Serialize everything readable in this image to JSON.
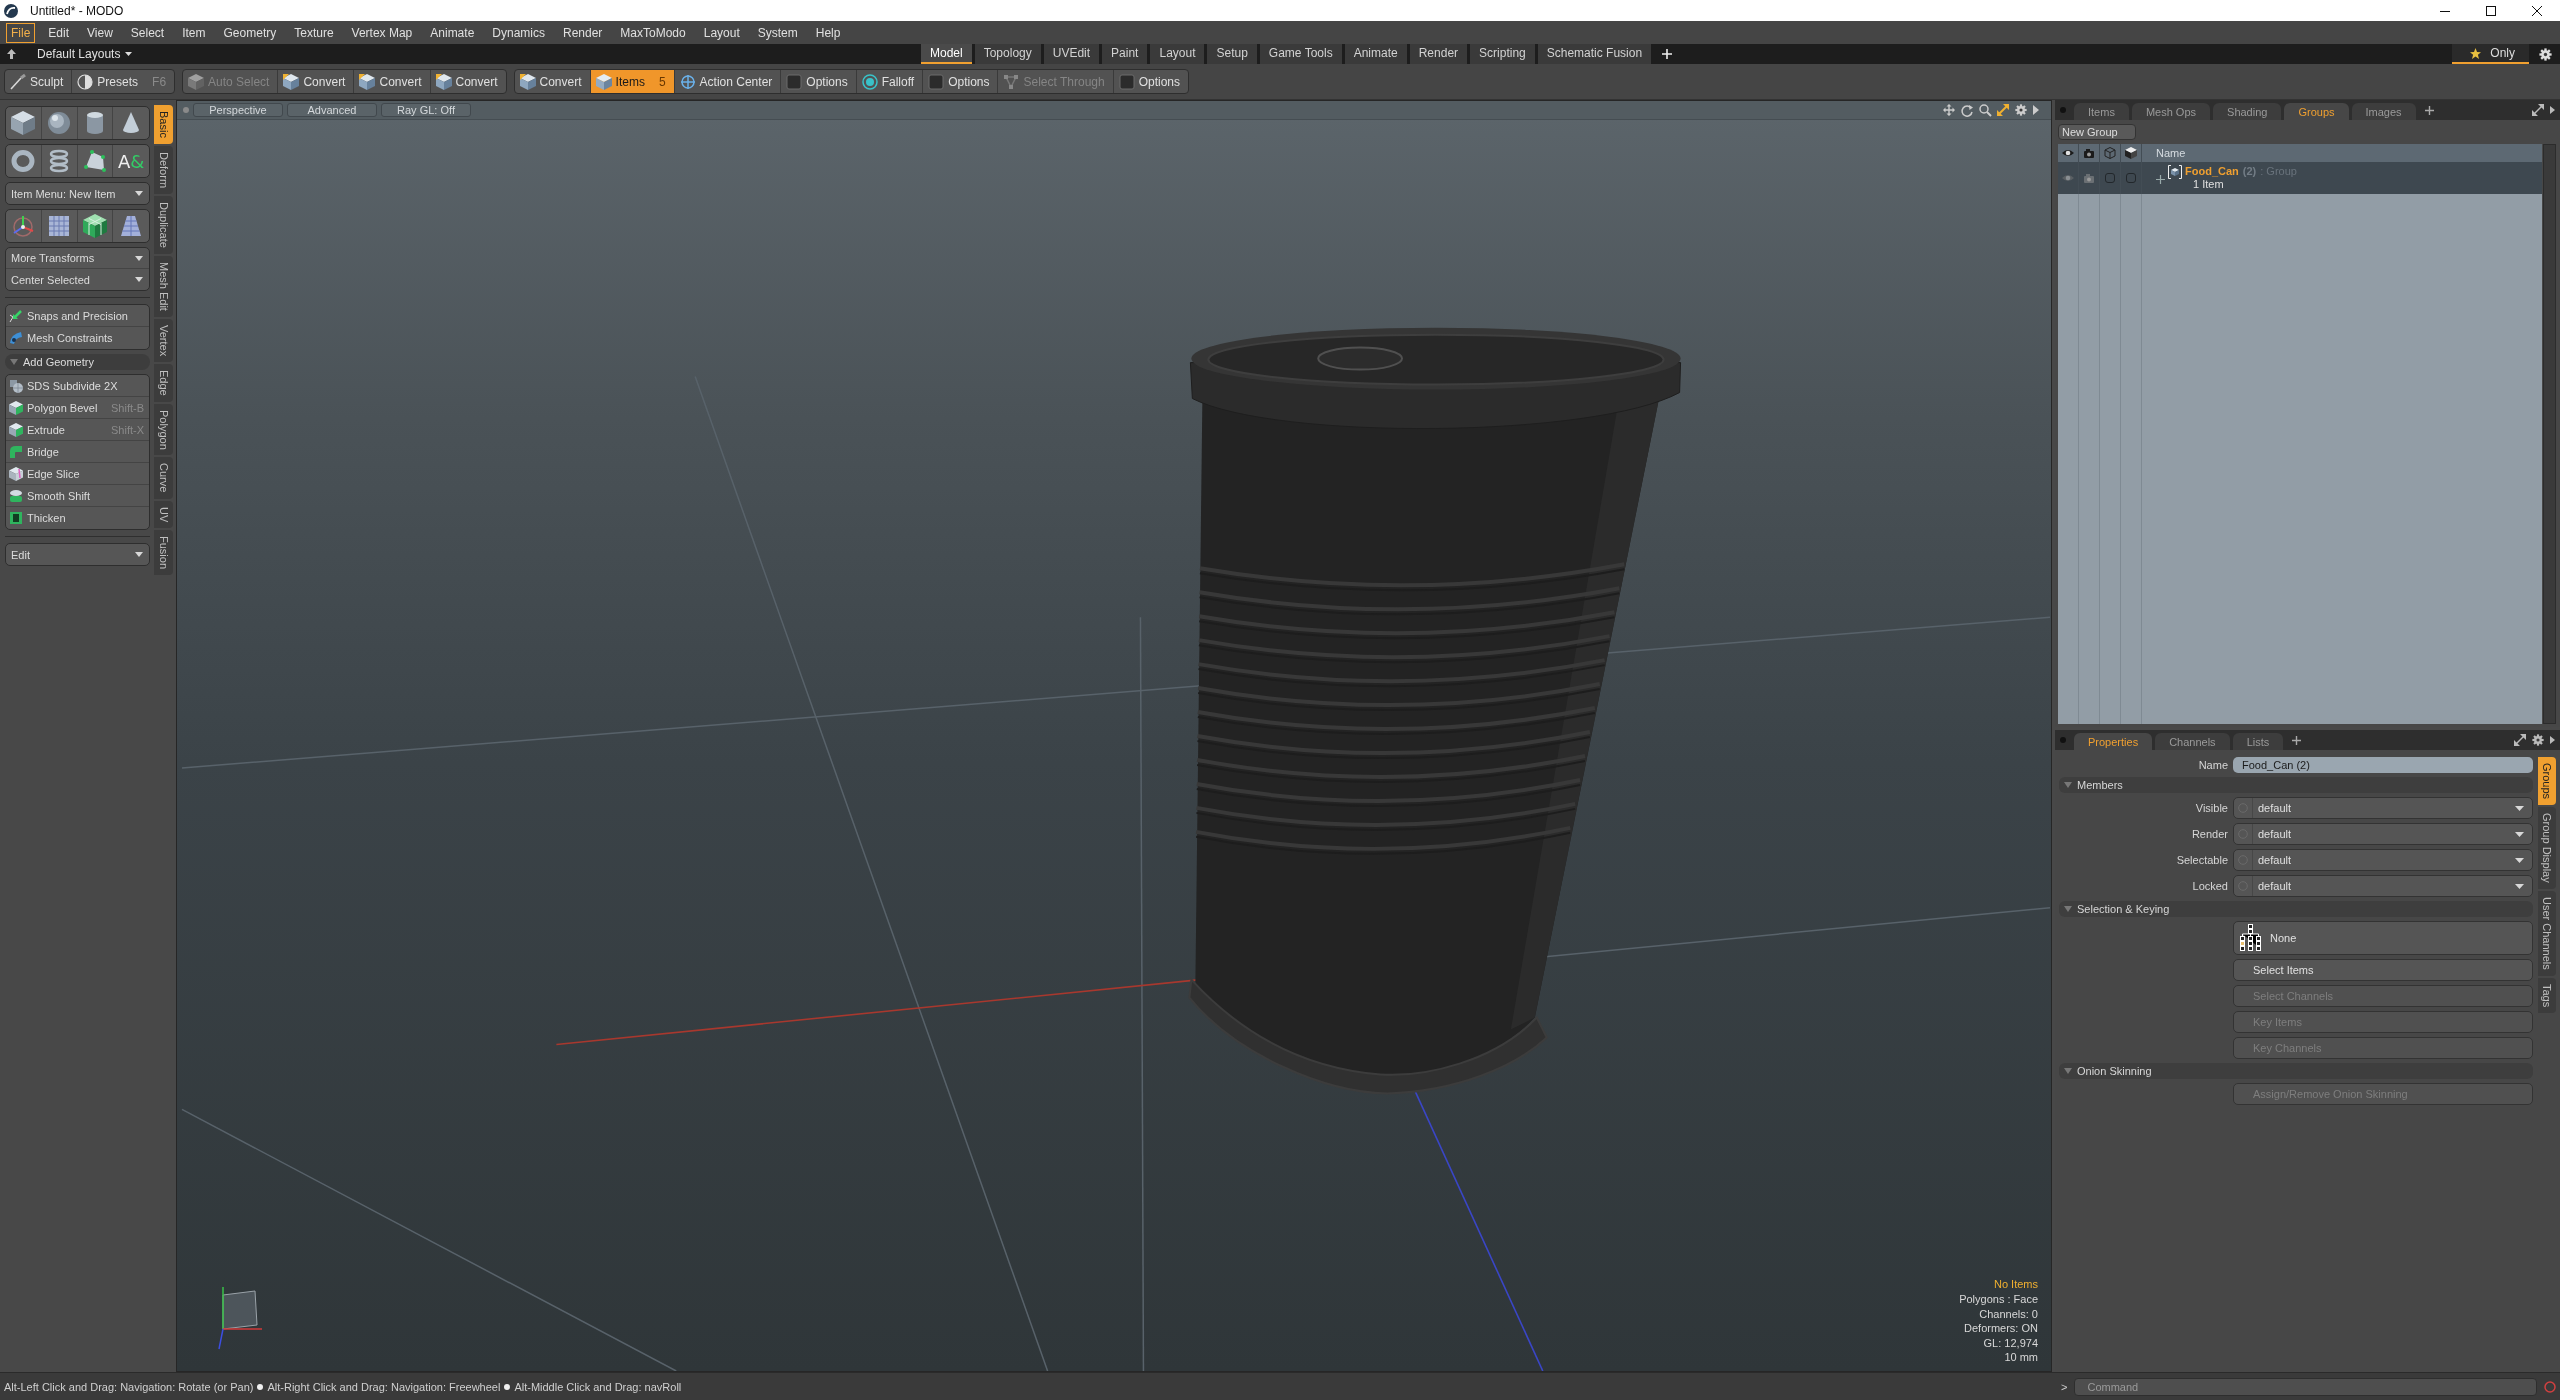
{
  "window": {
    "title": "Untitled* - MODO"
  },
  "menu_bar": [
    {
      "label": "File",
      "selected": true
    },
    {
      "label": "Edit",
      "selected": false
    },
    {
      "label": "View",
      "selected": false
    },
    {
      "label": "Select",
      "selected": false
    },
    {
      "label": "Item",
      "selected": false
    },
    {
      "label": "Geometry",
      "selected": false
    },
    {
      "label": "Texture",
      "selected": false
    },
    {
      "label": "Vertex Map",
      "selected": false
    },
    {
      "label": "Animate",
      "selected": false
    },
    {
      "label": "Dynamics",
      "selected": false
    },
    {
      "label": "Render",
      "selected": false
    },
    {
      "label": "MaxToModo",
      "selected": false
    },
    {
      "label": "Layout",
      "selected": false
    },
    {
      "label": "System",
      "selected": false
    },
    {
      "label": "Help",
      "selected": false
    }
  ],
  "layout_bar": {
    "layouts_menu": "Default Layouts",
    "tabs": [
      {
        "label": "Model",
        "selected": true
      },
      {
        "label": "Topology",
        "selected": false
      },
      {
        "label": "UVEdit",
        "selected": false
      },
      {
        "label": "Paint",
        "selected": false
      },
      {
        "label": "Layout",
        "selected": false
      },
      {
        "label": "Setup",
        "selected": false
      },
      {
        "label": "Game Tools",
        "selected": false
      },
      {
        "label": "Animate",
        "selected": false
      },
      {
        "label": "Render",
        "selected": false
      },
      {
        "label": "Scripting",
        "selected": false
      },
      {
        "label": "Schematic Fusion",
        "selected": false
      }
    ],
    "filter": {
      "label": "Only",
      "on": true
    }
  },
  "toolbar": [
    {
      "items": [
        {
          "label": "Sculpt",
          "selected": false,
          "disabled": false
        },
        {
          "label": "Presets",
          "shortcut": "F6",
          "selected": false,
          "disabled": false
        }
      ]
    },
    {
      "items": [
        {
          "label": "Auto Select",
          "selected": false,
          "disabled": true
        },
        {
          "label": "Convert",
          "selected": false,
          "disabled": false
        },
        {
          "label": "Convert",
          "selected": false,
          "disabled": false
        },
        {
          "label": "Convert",
          "selected": false,
          "disabled": false
        }
      ]
    },
    {
      "items": [
        {
          "label": "Convert",
          "selected": false,
          "disabled": false
        },
        {
          "label": "Items",
          "shortcut": "5",
          "selected": true,
          "disabled": false
        },
        {
          "label": "Action Center",
          "selected": false,
          "disabled": false
        },
        {
          "label": "Options",
          "selected": false,
          "disabled": false
        },
        {
          "label": "Falloff",
          "selected": false,
          "disabled": false
        },
        {
          "label": "Options",
          "selected": false,
          "disabled": false
        },
        {
          "label": "Select Through",
          "selected": false,
          "disabled": true
        },
        {
          "label": "Options",
          "selected": false,
          "disabled": false
        }
      ]
    }
  ],
  "toolbox": {
    "text_tool_glyph": "A&",
    "item_menu": "Item Menu: New Item",
    "transform_menus": [
      "More Transforms",
      "Center Selected"
    ],
    "tools": [
      {
        "label": "Snaps and Precision"
      },
      {
        "label": "Mesh Constraints"
      }
    ],
    "add_geometry": {
      "title": "Add Geometry",
      "expanded": true,
      "tools": [
        {
          "label": "SDS Subdivide 2X"
        },
        {
          "label": "Polygon Bevel",
          "shortcut": "Shift-B"
        },
        {
          "label": "Extrude",
          "shortcut": "Shift-X"
        },
        {
          "label": "Bridge"
        },
        {
          "label": "Edge Slice"
        },
        {
          "label": "Smooth Shift"
        },
        {
          "label": "Thicken"
        }
      ]
    },
    "edit_menu": "Edit",
    "tabs": [
      {
        "label": "Basic",
        "selected": true
      },
      {
        "label": "Deform",
        "selected": false
      },
      {
        "label": "Duplicate",
        "selected": false
      },
      {
        "label": "Mesh Edit",
        "selected": false
      },
      {
        "label": "Vertex",
        "selected": false
      },
      {
        "label": "Edge",
        "selected": false
      },
      {
        "label": "Polygon",
        "selected": false
      },
      {
        "label": "Curve",
        "selected": false
      },
      {
        "label": "UV",
        "selected": false
      },
      {
        "label": "Fusion",
        "selected": false
      }
    ]
  },
  "viewport": {
    "buttons": [
      "Perspective",
      "Advanced",
      "Ray GL: Off"
    ],
    "info": [
      {
        "kind": "alert",
        "text": "No Items"
      },
      {
        "kind": "stat",
        "text": "Polygons : Face"
      },
      {
        "kind": "stat",
        "text": "Channels: 0"
      },
      {
        "kind": "stat",
        "text": "Deformers: ON"
      },
      {
        "kind": "stat",
        "text": "GL: 12,974"
      },
      {
        "kind": "stat",
        "text": "10 mm"
      }
    ]
  },
  "items_panel": {
    "tabs": [
      {
        "label": "Items",
        "selected": false
      },
      {
        "label": "Mesh Ops",
        "selected": false
      },
      {
        "label": "Shading",
        "selected": false
      },
      {
        "label": "Groups",
        "selected": true
      },
      {
        "label": "Images",
        "selected": false
      }
    ],
    "new_group_button": "New Group",
    "column": "Name",
    "rows": [
      {
        "name": "Food_Can",
        "count": "(2)",
        "type": ": Group",
        "detail": "1 Item",
        "selected": true,
        "expanded": false,
        "checks": [
          {
            "checked": false
          },
          {
            "checked": false
          }
        ]
      }
    ]
  },
  "properties_panel": {
    "tabs": [
      {
        "label": "Properties",
        "selected": true
      },
      {
        "label": "Channels",
        "selected": false
      },
      {
        "label": "Lists",
        "selected": false
      }
    ],
    "name_label": "Name",
    "name_value": "Food_Can (2)",
    "sections": [
      {
        "title": "Members",
        "expanded": true,
        "rows": [
          {
            "kind": "dropdown",
            "label": "Visible",
            "value": "default"
          },
          {
            "kind": "dropdown",
            "label": "Render",
            "value": "default"
          },
          {
            "kind": "dropdown",
            "label": "Selectable",
            "value": "default"
          },
          {
            "kind": "dropdown",
            "label": "Locked",
            "value": "default"
          }
        ]
      },
      {
        "title": "Selection & Keying",
        "expanded": true,
        "rows": [
          {
            "kind": "hierarchy",
            "value": "None"
          },
          {
            "kind": "button",
            "label": "Select Items",
            "disabled": false
          },
          {
            "kind": "button",
            "label": "Select Channels",
            "disabled": true
          },
          {
            "kind": "button",
            "label": "Key Items",
            "disabled": true
          },
          {
            "kind": "button",
            "label": "Key Channels",
            "disabled": true
          }
        ]
      },
      {
        "title": "Onion Skinning",
        "expanded": true,
        "rows": [
          {
            "kind": "button",
            "label": "Assign/Remove Onion Skinning",
            "disabled": true
          }
        ]
      }
    ],
    "side_tabs": [
      {
        "label": "Groups",
        "selected": true
      },
      {
        "label": "Group Display",
        "selected": false
      },
      {
        "label": "User Channels",
        "selected": false
      },
      {
        "label": "Tags",
        "selected": false
      }
    ]
  },
  "status_bar": {
    "hints": [
      "Alt-Left Click and Drag: Navigation: Rotate (or Pan)",
      "Alt-Right Click and Drag: Navigation: Freewheel",
      "Alt-Middle Click and Drag: navRoll"
    ],
    "command": {
      "prompt": ">",
      "placeholder": "Command"
    }
  }
}
